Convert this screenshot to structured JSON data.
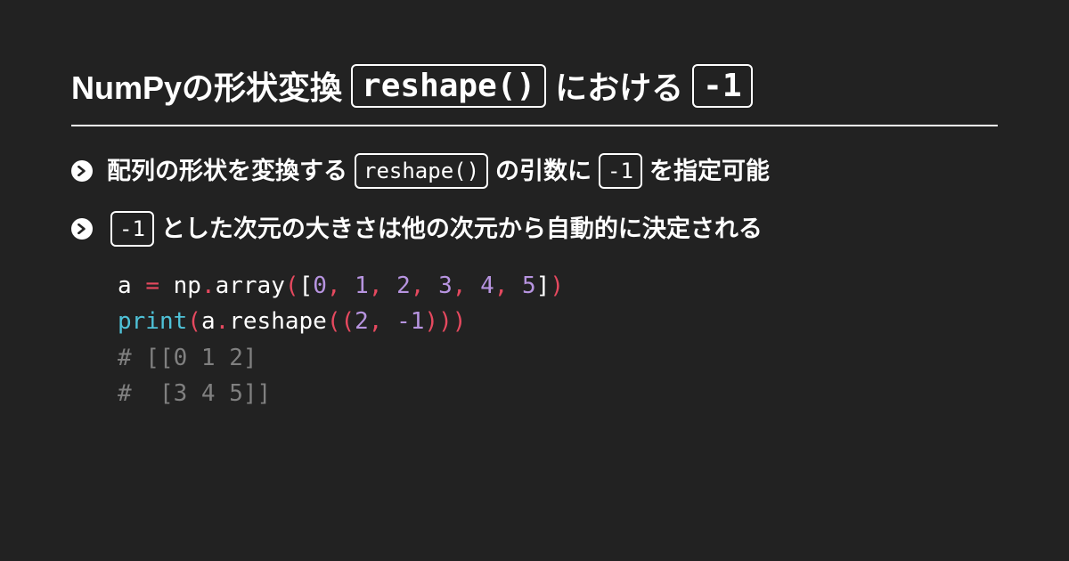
{
  "title": {
    "part1": "NumPyの形状変換",
    "code1": "reshape()",
    "part2": "における",
    "code2": "-1"
  },
  "bullets": [
    {
      "segments": [
        {
          "type": "text",
          "value": "配列の形状を変換する"
        },
        {
          "type": "code",
          "value": "reshape()"
        },
        {
          "type": "text",
          "value": "の引数に"
        },
        {
          "type": "code",
          "value": "-1"
        },
        {
          "type": "text",
          "value": "を指定可能"
        }
      ]
    },
    {
      "segments": [
        {
          "type": "code",
          "value": "-1"
        },
        {
          "type": "text",
          "value": "とした次元の大きさは他の次元から自動的に決定される"
        }
      ]
    }
  ],
  "code": {
    "lines": [
      [
        {
          "cls": "tok-default",
          "t": "a "
        },
        {
          "cls": "tok-punct",
          "t": "="
        },
        {
          "cls": "tok-default",
          "t": " np"
        },
        {
          "cls": "tok-punct",
          "t": "."
        },
        {
          "cls": "tok-default",
          "t": "array"
        },
        {
          "cls": "tok-punct",
          "t": "("
        },
        {
          "cls": "tok-default",
          "t": "["
        },
        {
          "cls": "tok-num",
          "t": "0"
        },
        {
          "cls": "tok-punct",
          "t": ","
        },
        {
          "cls": "tok-default",
          "t": " "
        },
        {
          "cls": "tok-num",
          "t": "1"
        },
        {
          "cls": "tok-punct",
          "t": ","
        },
        {
          "cls": "tok-default",
          "t": " "
        },
        {
          "cls": "tok-num",
          "t": "2"
        },
        {
          "cls": "tok-punct",
          "t": ","
        },
        {
          "cls": "tok-default",
          "t": " "
        },
        {
          "cls": "tok-num",
          "t": "3"
        },
        {
          "cls": "tok-punct",
          "t": ","
        },
        {
          "cls": "tok-default",
          "t": " "
        },
        {
          "cls": "tok-num",
          "t": "4"
        },
        {
          "cls": "tok-punct",
          "t": ","
        },
        {
          "cls": "tok-default",
          "t": " "
        },
        {
          "cls": "tok-num",
          "t": "5"
        },
        {
          "cls": "tok-default",
          "t": "]"
        },
        {
          "cls": "tok-punct",
          "t": ")"
        }
      ],
      [
        {
          "cls": "tok-func",
          "t": "print"
        },
        {
          "cls": "tok-punct",
          "t": "("
        },
        {
          "cls": "tok-default",
          "t": "a"
        },
        {
          "cls": "tok-punct",
          "t": "."
        },
        {
          "cls": "tok-default",
          "t": "reshape"
        },
        {
          "cls": "tok-punct",
          "t": "(("
        },
        {
          "cls": "tok-num",
          "t": "2"
        },
        {
          "cls": "tok-punct",
          "t": ","
        },
        {
          "cls": "tok-default",
          "t": " "
        },
        {
          "cls": "tok-num",
          "t": "-1"
        },
        {
          "cls": "tok-punct",
          "t": ")))"
        }
      ],
      [
        {
          "cls": "tok-comment",
          "t": "# [[0 1 2]"
        }
      ],
      [
        {
          "cls": "tok-comment",
          "t": "#  [3 4 5]]"
        }
      ]
    ]
  }
}
